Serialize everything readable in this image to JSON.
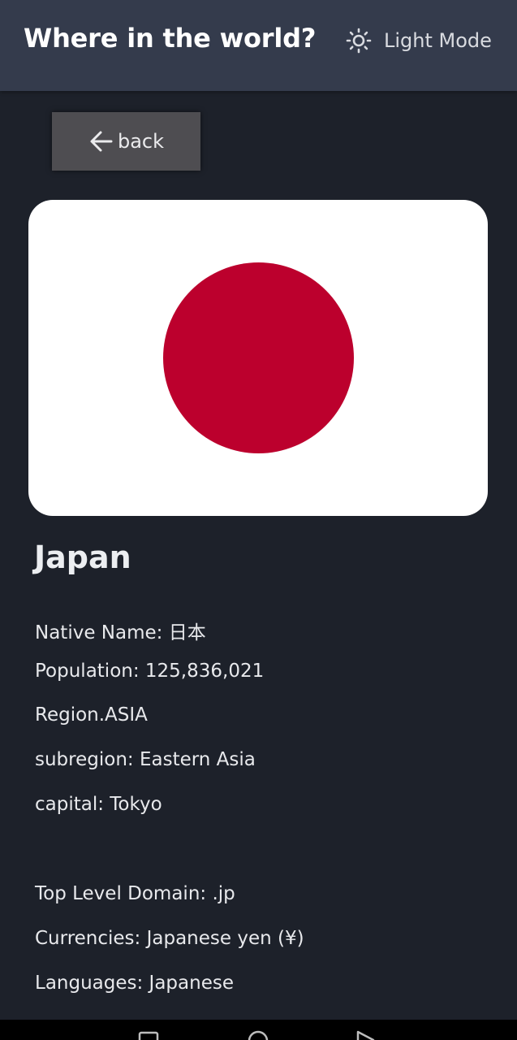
{
  "header": {
    "title": "Where in the world?",
    "theme_toggle_label": "Light Mode",
    "theme_icon": "sun-icon"
  },
  "back_button": {
    "label": "back",
    "icon": "arrow-left-icon"
  },
  "country": {
    "name": "Japan",
    "flag_colors": {
      "background": "#ffffff",
      "circle": "#bc002d"
    }
  },
  "details": {
    "native_name": "Native Name: 日本",
    "population": "Population: 125,836,021",
    "region": "Region.ASIA",
    "subregion": "subregion: Eastern Asia",
    "capital": "capital: Tokyo",
    "top_level_domain": "Top Level Domain: .jp",
    "currencies": "Currencies: Japanese yen (¥)",
    "languages": "Languages: Japanese"
  },
  "colors": {
    "page_background": "#1d212a",
    "header_background": "#343b4c",
    "button_background": "#4e4d51"
  },
  "system_nav": {
    "icons": [
      "recents-icon",
      "home-icon",
      "back-icon"
    ]
  }
}
